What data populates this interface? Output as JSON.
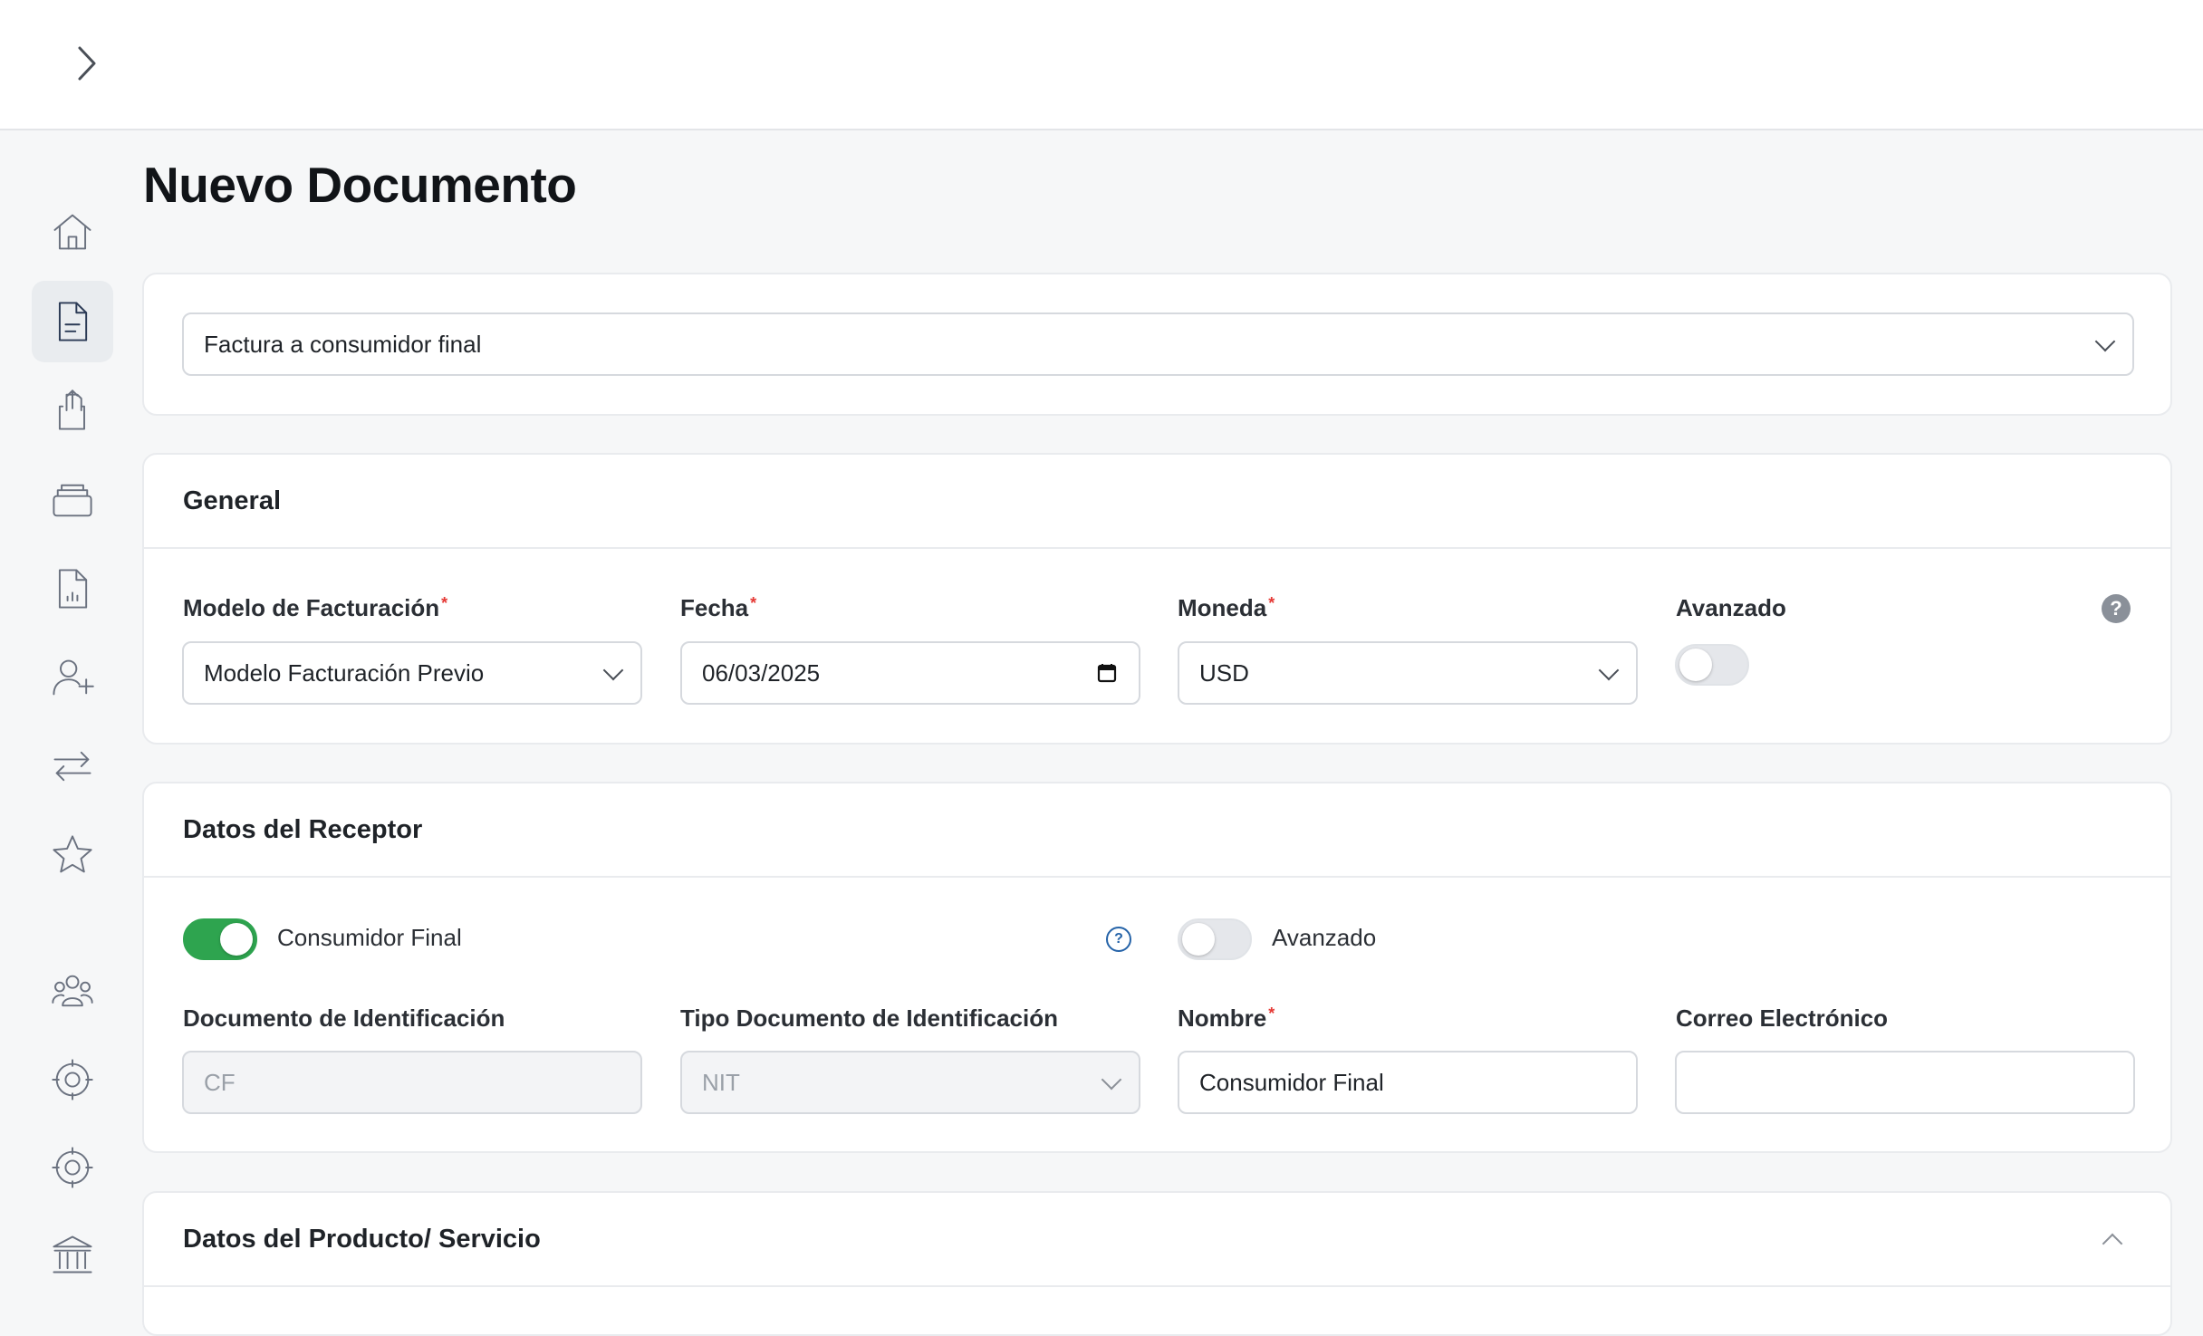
{
  "page": {
    "title": "Nuevo Documento"
  },
  "icons": {
    "expand": "chevron-right-icon",
    "nav": [
      "home-icon",
      "document-icon",
      "upload-document-icon",
      "inbox-icon",
      "report-icon",
      "add-user-icon",
      "transfer-icon",
      "star-icon",
      "users-icon",
      "settings-icon",
      "settings-icon",
      "bank-icon"
    ]
  },
  "document_type": {
    "value": "Factura a consumidor final"
  },
  "general": {
    "title": "General",
    "modelo_label": "Modelo de Facturación",
    "modelo_value": "Modelo Facturación Previo",
    "fecha_label": "Fecha",
    "fecha_value": "06/03/2025",
    "moneda_label": "Moneda",
    "moneda_value": "USD",
    "avanzado_label": "Avanzado",
    "avanzado_on": false,
    "help": "?"
  },
  "receptor": {
    "title": "Datos del Receptor",
    "consumidor_final_label": "Consumidor Final",
    "consumidor_final_on": true,
    "help": "?",
    "avanzado_label": "Avanzado",
    "avanzado_on": false,
    "doc_id_label": "Documento de Identificación",
    "doc_id_value": "CF",
    "tipo_doc_label": "Tipo Documento de Identificación",
    "tipo_doc_value": "NIT",
    "nombre_label": "Nombre",
    "nombre_value": "Consumidor Final",
    "correo_label": "Correo Electrónico",
    "correo_value": ""
  },
  "producto": {
    "title": "Datos del Producto/ Servicio"
  },
  "colors": {
    "toggle_on": "#2ea44f",
    "required": "#e53935",
    "help_link": "#2563a8"
  }
}
